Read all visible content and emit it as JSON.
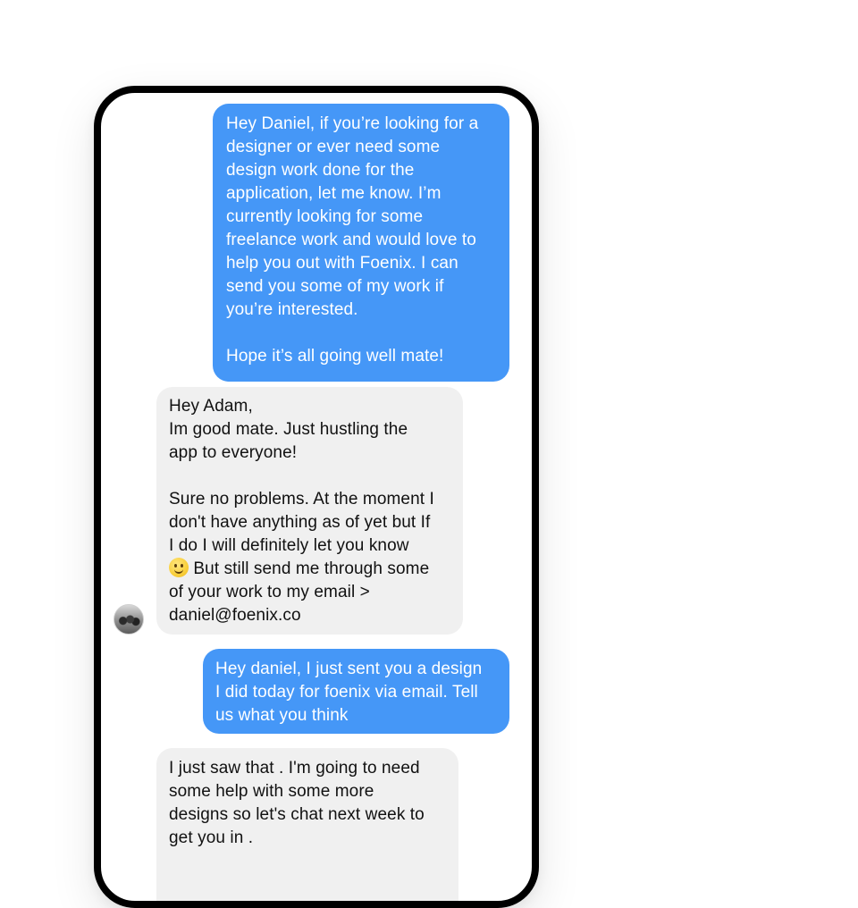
{
  "conversation": {
    "messages": [
      {
        "direction": "sent",
        "text": "Hey Daniel, if you’re looking for a\ndesigner or ever need some\ndesign work done for the\napplication, let me know. I’m\ncurrently looking for some\nfreelance work and would love to\nhelp you out with Foenix. I can\nsend you some of my work if\nyou’re interested.\n\nHope it’s all going well mate!"
      },
      {
        "direction": "received",
        "text_before_emoji": "Hey Adam,\nIm good mate. Just hustling the\napp to everyone!\n\nSure no problems. At the moment I\ndon't have anything as of yet but If\nI do I will definitely let you know\n",
        "emoji": "slightly-smiling-face",
        "text_after_emoji": " But still send me through some\nof your work to my email >\ndaniel@foenix.co"
      },
      {
        "direction": "sent",
        "text": "Hey daniel, I just sent you a design\nI did today for foenix via email. Tell\nus what you think"
      },
      {
        "direction": "received",
        "text": "I just saw that . I'm going to need\nsome help with some more\ndesigns so let's chat next week to\nget you in ."
      }
    ],
    "contact_avatar": "avatar-photo"
  },
  "colors": {
    "sent_bubble": "#4597f7",
    "received_bubble": "#f0f0f0",
    "device_frame": "#000000"
  }
}
